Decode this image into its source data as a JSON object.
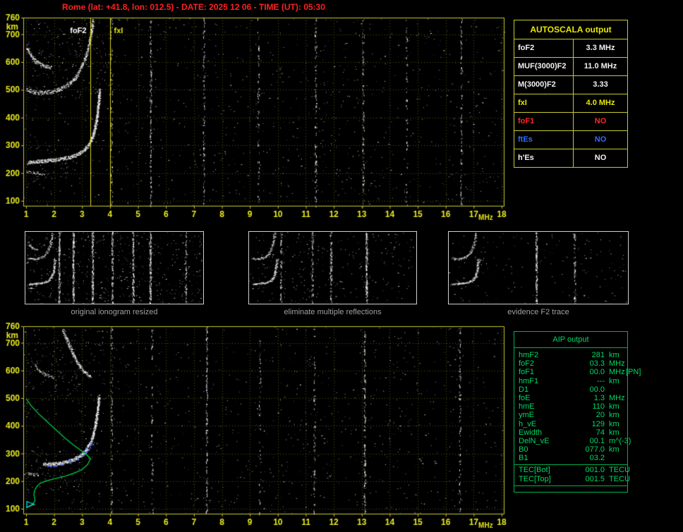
{
  "title": "Rome (lat: +41.8, lon: 012.5) - DATE: 2025 12 06 - TIME (UT): 05:30",
  "colors": {
    "title_red": "#ff2020",
    "axis_labels": "#e8e820",
    "plot_border": "#c8c832",
    "grid": "rgba(190,190,60,0.45)",
    "autoscala_border": "#c8c832",
    "aip_green": "#00d860",
    "aip_border": "#00b050",
    "caption_gray": "#a0a0a0",
    "profile_green": "#00c040",
    "fitted_blue": "#5a78ff",
    "es_cyan": "#00e8e8"
  },
  "autoscala_table": {
    "header": "AUTOSCALA output",
    "rows": [
      {
        "label": "foF2",
        "value": "3.3 MHz",
        "color": "#f2f2f2"
      },
      {
        "label": "MUF(3000)F2",
        "value": "11.0 MHz",
        "color": "#f2f2f2"
      },
      {
        "label": "M(3000)F2",
        "value": "3.33",
        "color": "#f2f2f2"
      },
      {
        "label": "fxI",
        "value": "4.0 MHz",
        "color": "#e8e800"
      },
      {
        "label": "foF1",
        "value": "NO",
        "color": "#ff2828"
      },
      {
        "label": "ftEs",
        "value": "NO",
        "color": "#2f6bff"
      },
      {
        "label": "h'Es",
        "value": "NO",
        "color": "#f2f2f2"
      }
    ]
  },
  "aip_table": {
    "header": "AIP output",
    "rows": [
      {
        "label": "hmF2",
        "value": "281",
        "unit": "km",
        "note": ""
      },
      {
        "label": "foF2",
        "value": "03.3",
        "unit": "MHz",
        "note": ""
      },
      {
        "label": "foF1",
        "value": "00.0",
        "unit": "MHz",
        "note": "[PN]"
      },
      {
        "label": "hmF1",
        "value": "---",
        "unit": "km",
        "note": ""
      },
      {
        "label": "D1",
        "value": "00.0",
        "unit": "",
        "note": ""
      },
      {
        "label": "foE",
        "value": "1.3",
        "unit": "MHz",
        "note": ""
      },
      {
        "label": "hmE",
        "value": "110",
        "unit": "km",
        "note": ""
      },
      {
        "label": "ymE",
        "value": "20",
        "unit": "km",
        "note": ""
      },
      {
        "label": "h_vE",
        "value": "129",
        "unit": "km",
        "note": ""
      },
      {
        "label": "Ewidth",
        "value": "74",
        "unit": "km",
        "note": ""
      },
      {
        "label": "DelN_vE",
        "value": "00.1",
        "unit": "m^(-3)",
        "note": ""
      },
      {
        "label": "B0",
        "value": "077.0",
        "unit": "km",
        "note": ""
      },
      {
        "label": "B1",
        "value": "03.2",
        "unit": "",
        "note": ""
      }
    ],
    "tec_rows": [
      {
        "label": "TEC[Bot]",
        "value": "001.0",
        "unit": "TECU"
      },
      {
        "label": "TEC[Top]",
        "value": "001.5",
        "unit": "TECU"
      }
    ]
  },
  "thumbnails": [
    {
      "caption": "original ionogram resized",
      "noise_dots": 520,
      "seed": 11,
      "trace_subset": [
        0,
        1,
        2,
        3
      ],
      "streaks": [
        4.05,
        5.45,
        7.35,
        9.3,
        11.35,
        13.05,
        16.55
      ]
    },
    {
      "caption": "eliminate multiple reflections",
      "noise_dots": 300,
      "seed": 12,
      "trace_subset": [
        0,
        1
      ],
      "streaks": [
        4.05,
        7.35,
        9.3,
        13.05
      ]
    },
    {
      "caption": "evidence F2 trace",
      "noise_dots": 170,
      "seed": 13,
      "trace_subset": [
        0,
        1
      ],
      "streaks": [
        9.3,
        13.05
      ]
    }
  ],
  "chart_data": [
    {
      "id": "main_ionogram",
      "type": "scatter",
      "title": "recorded ionogram with AUTOSCALA scaling",
      "xlabel": "MHz",
      "ylabel": "km",
      "xlim": [
        1,
        18
      ],
      "ylim": [
        100,
        760
      ],
      "x_ticks": [
        1,
        2,
        3,
        4,
        5,
        6,
        7,
        8,
        9,
        10,
        11,
        12,
        13,
        14,
        15,
        16,
        17,
        18
      ],
      "y_ticks": [
        760,
        700,
        600,
        500,
        400,
        300,
        200,
        100
      ],
      "grid": true,
      "seed": 7,
      "noise_dots": 1050,
      "interference_lines_mhz": [
        4.05,
        5.45,
        7.35,
        9.3,
        11.35,
        13.05,
        14.6,
        16.55
      ],
      "noise_patches": [
        {
          "x": [
            1,
            4.2
          ],
          "y": [
            480,
            760
          ],
          "n": 160
        },
        {
          "x": [
            1,
            3
          ],
          "y": [
            150,
            300
          ],
          "n": 60
        }
      ],
      "markers": [
        {
          "label": "foF2",
          "x": 3.3,
          "label_color": "#ffffff",
          "line_color": "#d8d820",
          "label_side": "left"
        },
        {
          "label": "fxI",
          "x": 4.0,
          "label_color": "#e8e800",
          "line_color": "#d8d820",
          "label_side": "right"
        }
      ],
      "scaled_values": {
        "foF2_MHz": 3.3,
        "MUF3000F2_MHz": 11.0,
        "M3000F2": 3.33,
        "fxI_MHz": 4.0
      },
      "traces": [
        {
          "name": "F2-trace",
          "density": 3,
          "spread": 5,
          "points": [
            [
              1.05,
              238
            ],
            [
              1.4,
              242
            ],
            [
              1.8,
              246
            ],
            [
              2.2,
              251
            ],
            [
              2.6,
              259
            ],
            [
              2.9,
              271
            ],
            [
              3.1,
              286
            ],
            [
              3.25,
              306
            ],
            [
              3.37,
              332
            ],
            [
              3.46,
              366
            ],
            [
              3.53,
              406
            ],
            [
              3.58,
              452
            ],
            [
              3.62,
              498
            ]
          ]
        },
        {
          "name": "second-hop-echo",
          "density": 2,
          "spread": 6,
          "points": [
            [
              1.0,
              500
            ],
            [
              1.3,
              492
            ],
            [
              1.65,
              490
            ],
            [
              2.0,
              496
            ],
            [
              2.3,
              507
            ],
            [
              2.6,
              527
            ],
            [
              2.82,
              553
            ],
            [
              3.0,
              588
            ],
            [
              3.15,
              628
            ],
            [
              3.25,
              668
            ],
            [
              3.33,
              710
            ],
            [
              3.38,
              752
            ]
          ]
        },
        {
          "name": "upper-echo-arc",
          "density": 2,
          "spread": 5,
          "points": [
            [
              1.0,
              655
            ],
            [
              1.15,
              626
            ],
            [
              1.35,
              602
            ],
            [
              1.6,
              587
            ],
            [
              1.88,
              580
            ]
          ]
        },
        {
          "name": "low-echo-bits",
          "density": 1,
          "spread": 4,
          "points": [
            [
              1.0,
              206
            ],
            [
              1.3,
              201
            ],
            [
              1.6,
              198
            ]
          ]
        }
      ]
    },
    {
      "id": "profile_ionogram",
      "type": "scatter",
      "title": "ionogram with restored electron density profile (AIP)",
      "xlabel": "MHz",
      "ylabel": "km",
      "xlim": [
        1,
        18
      ],
      "ylim": [
        100,
        760
      ],
      "x_ticks": [
        1,
        2,
        3,
        4,
        5,
        6,
        7,
        8,
        9,
        10,
        11,
        12,
        13,
        14,
        15,
        16,
        17,
        18
      ],
      "y_ticks": [
        760,
        700,
        600,
        500,
        400,
        300,
        200,
        100
      ],
      "grid": true,
      "seed": 21,
      "noise_dots": 1000,
      "interference_lines_mhz": [
        4.05,
        5.5,
        7.45,
        9.35,
        11.3,
        13.1,
        16.5
      ],
      "noise_patches": [
        {
          "x": [
            1,
            4.2
          ],
          "y": [
            480,
            760
          ],
          "n": 140
        },
        {
          "x": [
            1,
            3
          ],
          "y": [
            150,
            320
          ],
          "n": 70
        }
      ],
      "markers": [],
      "traces": [
        {
          "name": "F2-trace",
          "density": 3,
          "spread": 5,
          "points": [
            [
              1.6,
              262
            ],
            [
              2.0,
              263
            ],
            [
              2.4,
              269
            ],
            [
              2.7,
              279
            ],
            [
              2.95,
              293
            ],
            [
              3.15,
              313
            ],
            [
              3.3,
              341
            ],
            [
              3.42,
              379
            ],
            [
              3.5,
              421
            ],
            [
              3.56,
              466
            ],
            [
              3.6,
              506
            ]
          ]
        },
        {
          "name": "upper-echo",
          "density": 2,
          "spread": 5,
          "points": [
            [
              2.3,
              748
            ],
            [
              2.5,
              700
            ],
            [
              2.7,
              652
            ],
            [
              2.9,
              616
            ],
            [
              3.1,
              592
            ],
            [
              3.3,
              577
            ]
          ]
        },
        {
          "name": "left-echo",
          "density": 1,
          "spread": 4,
          "points": [
            [
              1.3,
              620
            ],
            [
              1.5,
              596
            ],
            [
              1.75,
              582
            ],
            [
              2.0,
              573
            ]
          ]
        },
        {
          "name": "low-bits",
          "density": 1,
          "spread": 4,
          "points": [
            [
              1.0,
              230
            ],
            [
              1.2,
              226
            ],
            [
              1.45,
              222
            ]
          ]
        }
      ],
      "profile_curve": {
        "name": "electron-density-profile",
        "color": "#00c040",
        "points": [
          [
            1.0,
            498
          ],
          [
            1.2,
            470
          ],
          [
            1.5,
            438
          ],
          [
            1.8,
            410
          ],
          [
            2.1,
            382
          ],
          [
            2.4,
            355
          ],
          [
            2.7,
            330
          ],
          [
            3.0,
            308
          ],
          [
            3.2,
            292
          ],
          [
            3.3,
            281
          ],
          [
            3.2,
            260
          ],
          [
            3.0,
            242
          ],
          [
            2.7,
            228
          ],
          [
            2.4,
            218
          ],
          [
            2.0,
            208
          ],
          [
            1.7,
            200
          ],
          [
            1.5,
            192
          ],
          [
            1.38,
            180
          ],
          [
            1.3,
            165
          ],
          [
            1.28,
            150
          ],
          [
            1.31,
            138
          ],
          [
            1.32,
            129
          ],
          [
            1.25,
            118
          ],
          [
            1.1,
            108
          ],
          [
            1.0,
            103
          ]
        ]
      },
      "fitted_trace_points": [
        [
          1.8,
          258
        ],
        [
          2.05,
          261
        ],
        [
          2.3,
          266
        ],
        [
          2.55,
          272
        ],
        [
          2.8,
          284
        ],
        [
          3.0,
          296
        ],
        [
          3.1,
          305
        ],
        [
          3.2,
          318
        ],
        [
          3.3,
          335
        ]
      ],
      "fitted_color": "#5a78ff",
      "es_marker": {
        "x": 1.15,
        "y": 116,
        "color": "#00e8e8"
      }
    }
  ]
}
